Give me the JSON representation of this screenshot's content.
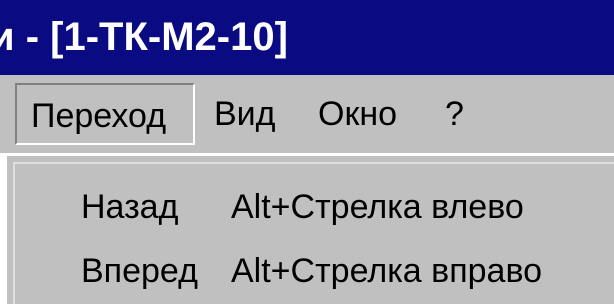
{
  "window": {
    "title": "и - [1-ТК-М2-10]"
  },
  "menubar": {
    "items": [
      {
        "label": "Переход"
      },
      {
        "label": "Вид"
      },
      {
        "label": "Окно"
      },
      {
        "label": "?"
      }
    ]
  },
  "dropdown": {
    "items": [
      {
        "label": "Назад",
        "shortcut": "Alt+Стрелка влево"
      },
      {
        "label": "Вперед",
        "shortcut": "Alt+Стрелка вправо"
      }
    ]
  }
}
